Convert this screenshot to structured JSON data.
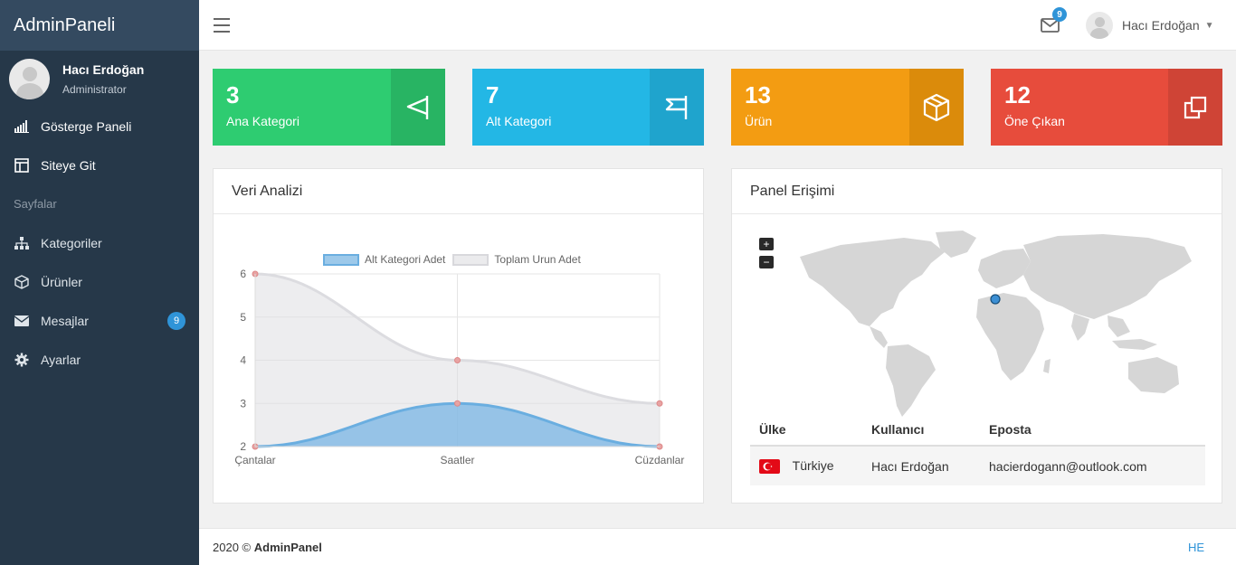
{
  "brand": "AdminPaneli",
  "sidebar": {
    "user_name": "Hacı Erdoğan",
    "user_role": "Administrator",
    "items": [
      {
        "label": "Gösterge Paneli",
        "icon": "bar-chart-icon"
      },
      {
        "label": "Siteye Git",
        "icon": "layout-icon"
      }
    ],
    "section_label": "Sayfalar",
    "pages": [
      {
        "label": "Kategoriler",
        "icon": "sitemap-icon"
      },
      {
        "label": "Ürünler",
        "icon": "cube-icon"
      },
      {
        "label": "Mesajlar",
        "icon": "envelope-icon",
        "badge": "9"
      },
      {
        "label": "Ayarlar",
        "icon": "gear-icon"
      }
    ]
  },
  "topbar": {
    "mail_badge": "9",
    "user_name": "Hacı Erdoğan"
  },
  "stats": [
    {
      "value": "3",
      "label": "Ana Kategori",
      "color": "#2ecc71",
      "icon_bg": "#28b463",
      "icon": "flag-icon"
    },
    {
      "value": "7",
      "label": "Alt Kategori",
      "color": "#23b7e5",
      "icon_bg": "#1fa4cd",
      "icon": "flag-icon"
    },
    {
      "value": "13",
      "label": "Ürün",
      "color": "#f39c12",
      "icon_bg": "#db8b0b",
      "icon": "cube-icon"
    },
    {
      "value": "12",
      "label": "Öne Çıkan",
      "color": "#e74c3c",
      "icon_bg": "#cf4436",
      "icon": "clone-icon"
    }
  ],
  "chart_panel": {
    "title": "Veri Analizi"
  },
  "chart_data": {
    "type": "area",
    "x": [
      "Çantalar",
      "Saatler",
      "Cüzdanlar"
    ],
    "series": [
      {
        "name": "Alt Kategori Adet",
        "values": [
          2,
          3,
          2
        ],
        "color": "#7ab8e3"
      },
      {
        "name": "Toplam Urun Adet",
        "values": [
          6,
          4,
          3
        ],
        "color": "#e3e3e6"
      }
    ],
    "ylim": [
      2,
      6
    ],
    "yticks": [
      "2",
      "3",
      "4",
      "5",
      "6"
    ],
    "legend_position": "top"
  },
  "access_panel": {
    "title": "Panel Erişimi",
    "zoom_in": "+",
    "zoom_out": "−",
    "columns": [
      "Ülke",
      "Kullanıcı",
      "Eposta"
    ],
    "rows": [
      {
        "country": "Türkiye",
        "user": "Hacı Erdoğan",
        "email": "hacierdogann@outlook.com"
      }
    ]
  },
  "footer": {
    "year": "2020 ©",
    "name": "AdminPanel",
    "right": "HE"
  }
}
